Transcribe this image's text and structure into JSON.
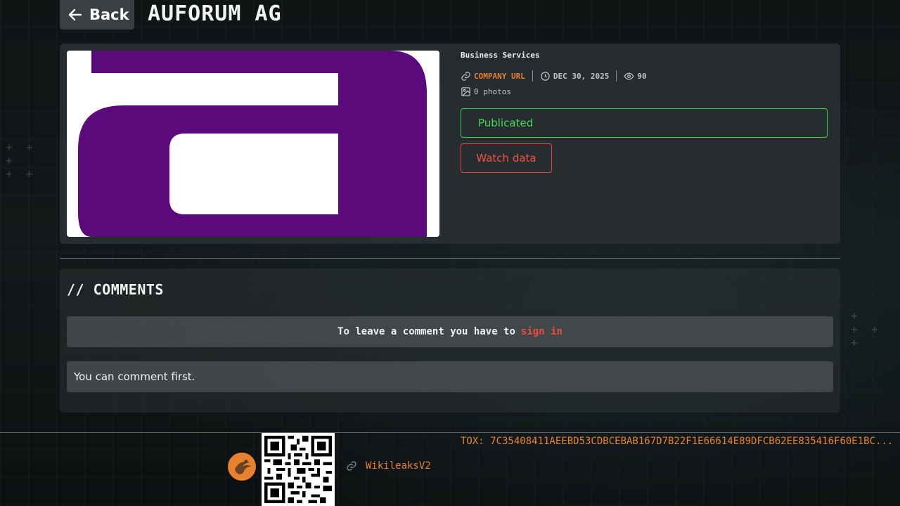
{
  "header": {
    "back_label": "Back",
    "title": "AUFORUM AG"
  },
  "company": {
    "logo_name": "auforum-logo",
    "category": "Business Services",
    "url_label": "COMPANY URL",
    "date": "DEC 30, 2025",
    "views": "90",
    "photos": "0 photos",
    "status": "Publicated",
    "watch_label": "Watch data"
  },
  "comments": {
    "title": "// COMMENTS",
    "signin_prefix": "To leave a comment you have to",
    "signin_link": "sign in",
    "empty_message": "You can comment first."
  },
  "footer": {
    "link_label": "WikileaksV2",
    "tox": "TOX: 7C35408411AEEBD53CDBCEBAB167D7B22F1E66614E89DFCB62EE835416F60E1BC..."
  },
  "colors": {
    "accent_orange": "#e8812f",
    "status_green": "#3ad24a",
    "alert_red": "#ef5346",
    "logo_purple": "#5a0a7a"
  }
}
